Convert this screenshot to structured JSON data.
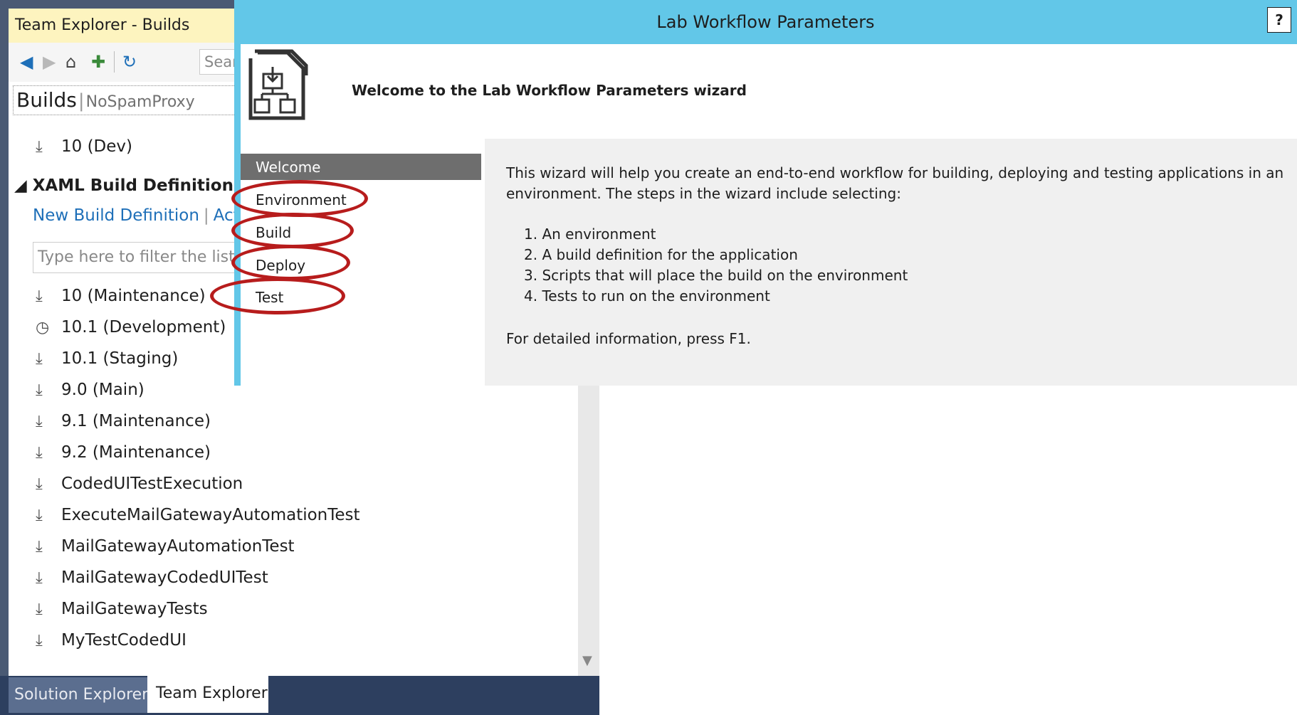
{
  "team_explorer": {
    "title": "Team Explorer - Builds",
    "search_placeholder": "Search",
    "page_title": "Builds",
    "page_separator": "|",
    "project": "NoSpamProxy",
    "my_builds": [
      {
        "label": "10 (Dev)",
        "icon": "download-icon"
      }
    ],
    "section_header": "◢ XAML Build Definitions (sh",
    "link_new": "New Build Definition",
    "link_separator": "|",
    "link_actions": "Acti",
    "filter_placeholder": "Type here to filter the list",
    "definitions": [
      {
        "label": "10 (Maintenance)",
        "icon": "download-icon"
      },
      {
        "label": "10.1 (Development)",
        "icon": "clock-icon"
      },
      {
        "label": "10.1 (Staging)",
        "icon": "download-icon"
      },
      {
        "label": "9.0 (Main)",
        "icon": "download-icon"
      },
      {
        "label": "9.1 (Maintenance)",
        "icon": "download-icon"
      },
      {
        "label": "9.2 (Maintenance)",
        "icon": "download-icon"
      },
      {
        "label": "CodedUITestExecution",
        "icon": "download-icon"
      },
      {
        "label": "ExecuteMailGatewayAutomationTest",
        "icon": "download-icon"
      },
      {
        "label": "MailGatewayAutomationTest",
        "icon": "download-icon"
      },
      {
        "label": "MailGatewayCodedUITest",
        "icon": "download-icon"
      },
      {
        "label": "MailGatewayTests",
        "icon": "download-icon"
      },
      {
        "label": "MyTestCodedUI",
        "icon": "download-icon"
      }
    ],
    "tabs": {
      "solution_explorer": "Solution Explorer",
      "team_explorer": "Team Explorer"
    }
  },
  "wizard": {
    "title": "Lab Workflow Parameters",
    "help": "?",
    "heading": "Welcome to the Lab Workflow Parameters wizard",
    "nav": [
      "Welcome",
      "Environment",
      "Build",
      "Deploy",
      "Test"
    ],
    "selected_nav": "Welcome",
    "intro_line1": "This wizard will help you create an end-to-end workflow for building, deploying and testing applications in an",
    "intro_line2": "environment. The steps in the wizard include selecting:",
    "steps": [
      "1.  An environment",
      "2.  A build definition for the application",
      "3.  Scripts that will place the build on the environment",
      "4.  Tests to run on the environment"
    ],
    "footer": "For detailed information, press F1."
  },
  "colors": {
    "titlebar": "#62c7e8",
    "team_explorer_title_bg": "#fdf4bf",
    "link": "#1e6fb8",
    "nav_selected": "#6e6e6e",
    "highlight_ring": "#b71c1c",
    "bottom_bar": "#2d3f5f"
  }
}
